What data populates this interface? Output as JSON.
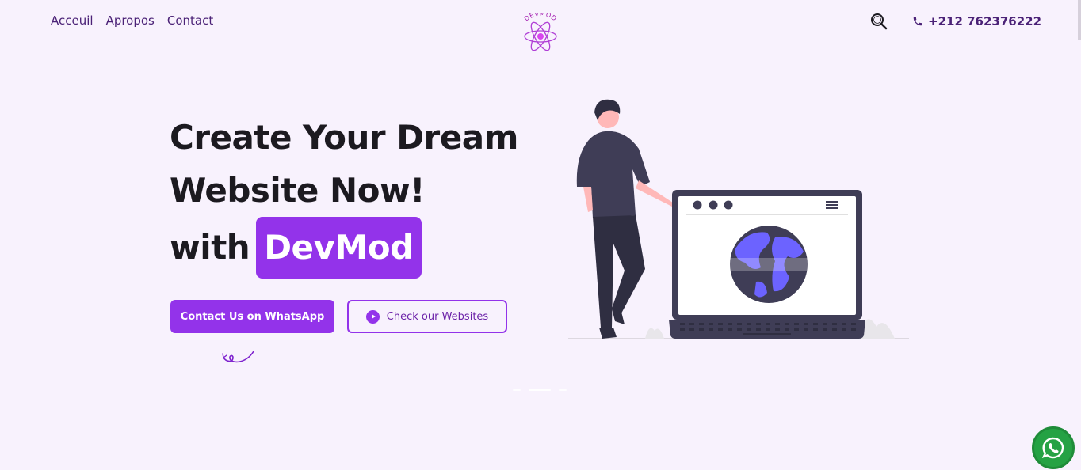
{
  "nav": {
    "items": [
      {
        "label": "Acceuil"
      },
      {
        "label": "Apropos"
      },
      {
        "label": "Contact"
      }
    ]
  },
  "logo": {
    "text": "DEVMOD"
  },
  "header": {
    "phone": "+212 762376222"
  },
  "hero": {
    "line1": "Create Your Dream",
    "line2": "Website Now!",
    "line3_prefix": "with",
    "brand": "DevMod",
    "primary_cta": "Contact Us on WhatsApp",
    "secondary_cta": "Check our Websites"
  },
  "colors": {
    "accent": "#9333ea",
    "nav_text": "#4b2277",
    "background": "#f8f2fd",
    "whatsapp": "#25a244"
  },
  "icons": [
    "search-icon",
    "phone-icon",
    "play-icon",
    "whatsapp-icon",
    "logo-atom-icon"
  ]
}
